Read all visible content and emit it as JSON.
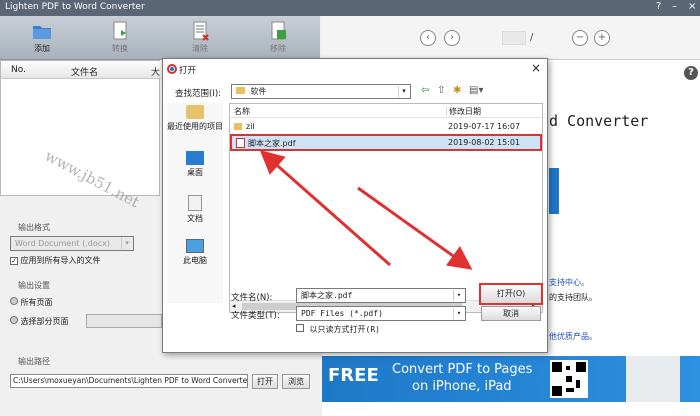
{
  "window": {
    "title": "Lighten PDF to Word Converter",
    "help": "?",
    "minimize": "–",
    "close": "×"
  },
  "toolbar": {
    "add": "添加",
    "convert": "转换",
    "clear": "清除",
    "remove": "移除"
  },
  "file_table": {
    "col_no": "No.",
    "col_name": "文件名",
    "col_size": "大"
  },
  "output_format": {
    "group_label": "输出格式",
    "selected": "Word Document (.docx)",
    "apply_all": "应用到所有导入的文件"
  },
  "output_settings": {
    "group_label": "输出设置",
    "all_pages": "所有页面",
    "some_pages": "选择部分页面"
  },
  "output_path": {
    "group_label": "输出路径",
    "value": "C:\\Users\\moxueyan\\Documents\\Lighten PDF to Word Converter",
    "open": "打开",
    "browse": "浏览"
  },
  "preview": {
    "page_sep": "/",
    "help": "?",
    "heading_fragment": "d Converter",
    "line1": "支持中心。",
    "line2": "的支持团队。",
    "line3": "他优质产品。"
  },
  "banner": {
    "free": "FREE",
    "line1": "Convert PDF to Pages",
    "line2": "on iPhone, iPad"
  },
  "watermark": "www.jb51.net",
  "dialog": {
    "title": "打开",
    "look_in_label": "查找范围(I):",
    "look_in_value": "软件",
    "places": [
      "最近使用的项目",
      "桌面",
      "文档",
      "此电脑"
    ],
    "col_name": "名称",
    "col_date": "修改日期",
    "files": [
      {
        "name": "zil",
        "date": "2019-07-17 16:07"
      },
      {
        "name": "脚本之家.pdf",
        "date": "2019-08-02 15:01"
      }
    ],
    "filename_label": "文件名(N):",
    "filename_value": "脚本之家.pdf",
    "filetype_label": "文件类型(T):",
    "filetype_value": "PDF Files (*.pdf)",
    "readonly_label": "以只读方式打开(R)",
    "open_button": "打开(O)",
    "cancel_button": "取消",
    "close": "×"
  },
  "colors": {
    "highlight": "#e03030",
    "titlebar": "#5a6676",
    "banner": "#1e78c8"
  }
}
